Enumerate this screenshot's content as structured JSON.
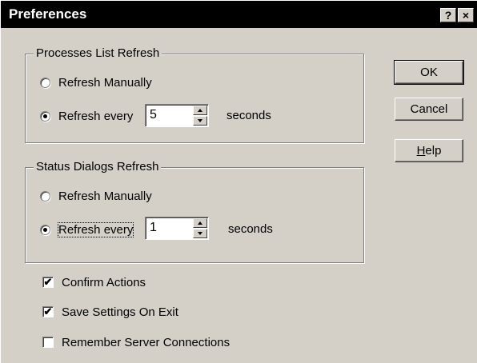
{
  "window": {
    "title": "Preferences",
    "help_glyph": "?",
    "close_glyph": "×"
  },
  "processes_group": {
    "legend": "Processes List Refresh",
    "manual_label": "Refresh Manually",
    "every_label": "Refresh every",
    "selected": "every",
    "interval_value": "5",
    "units_label": "seconds"
  },
  "status_group": {
    "legend": "Status Dialogs Refresh",
    "manual_label": "Refresh Manually",
    "every_label": "Refresh every",
    "selected": "every",
    "interval_value": "1",
    "units_label": "seconds"
  },
  "options": [
    {
      "label": "Confirm Actions",
      "checked": true
    },
    {
      "label": "Save Settings On Exit",
      "checked": true
    },
    {
      "label": "Remember Server Connections",
      "checked": false
    }
  ],
  "buttons": {
    "ok_label": "OK",
    "cancel_label": "Cancel",
    "help_label_prefix": "H",
    "help_label_rest": "elp"
  },
  "glyphs": {
    "check_mark": "✔"
  }
}
